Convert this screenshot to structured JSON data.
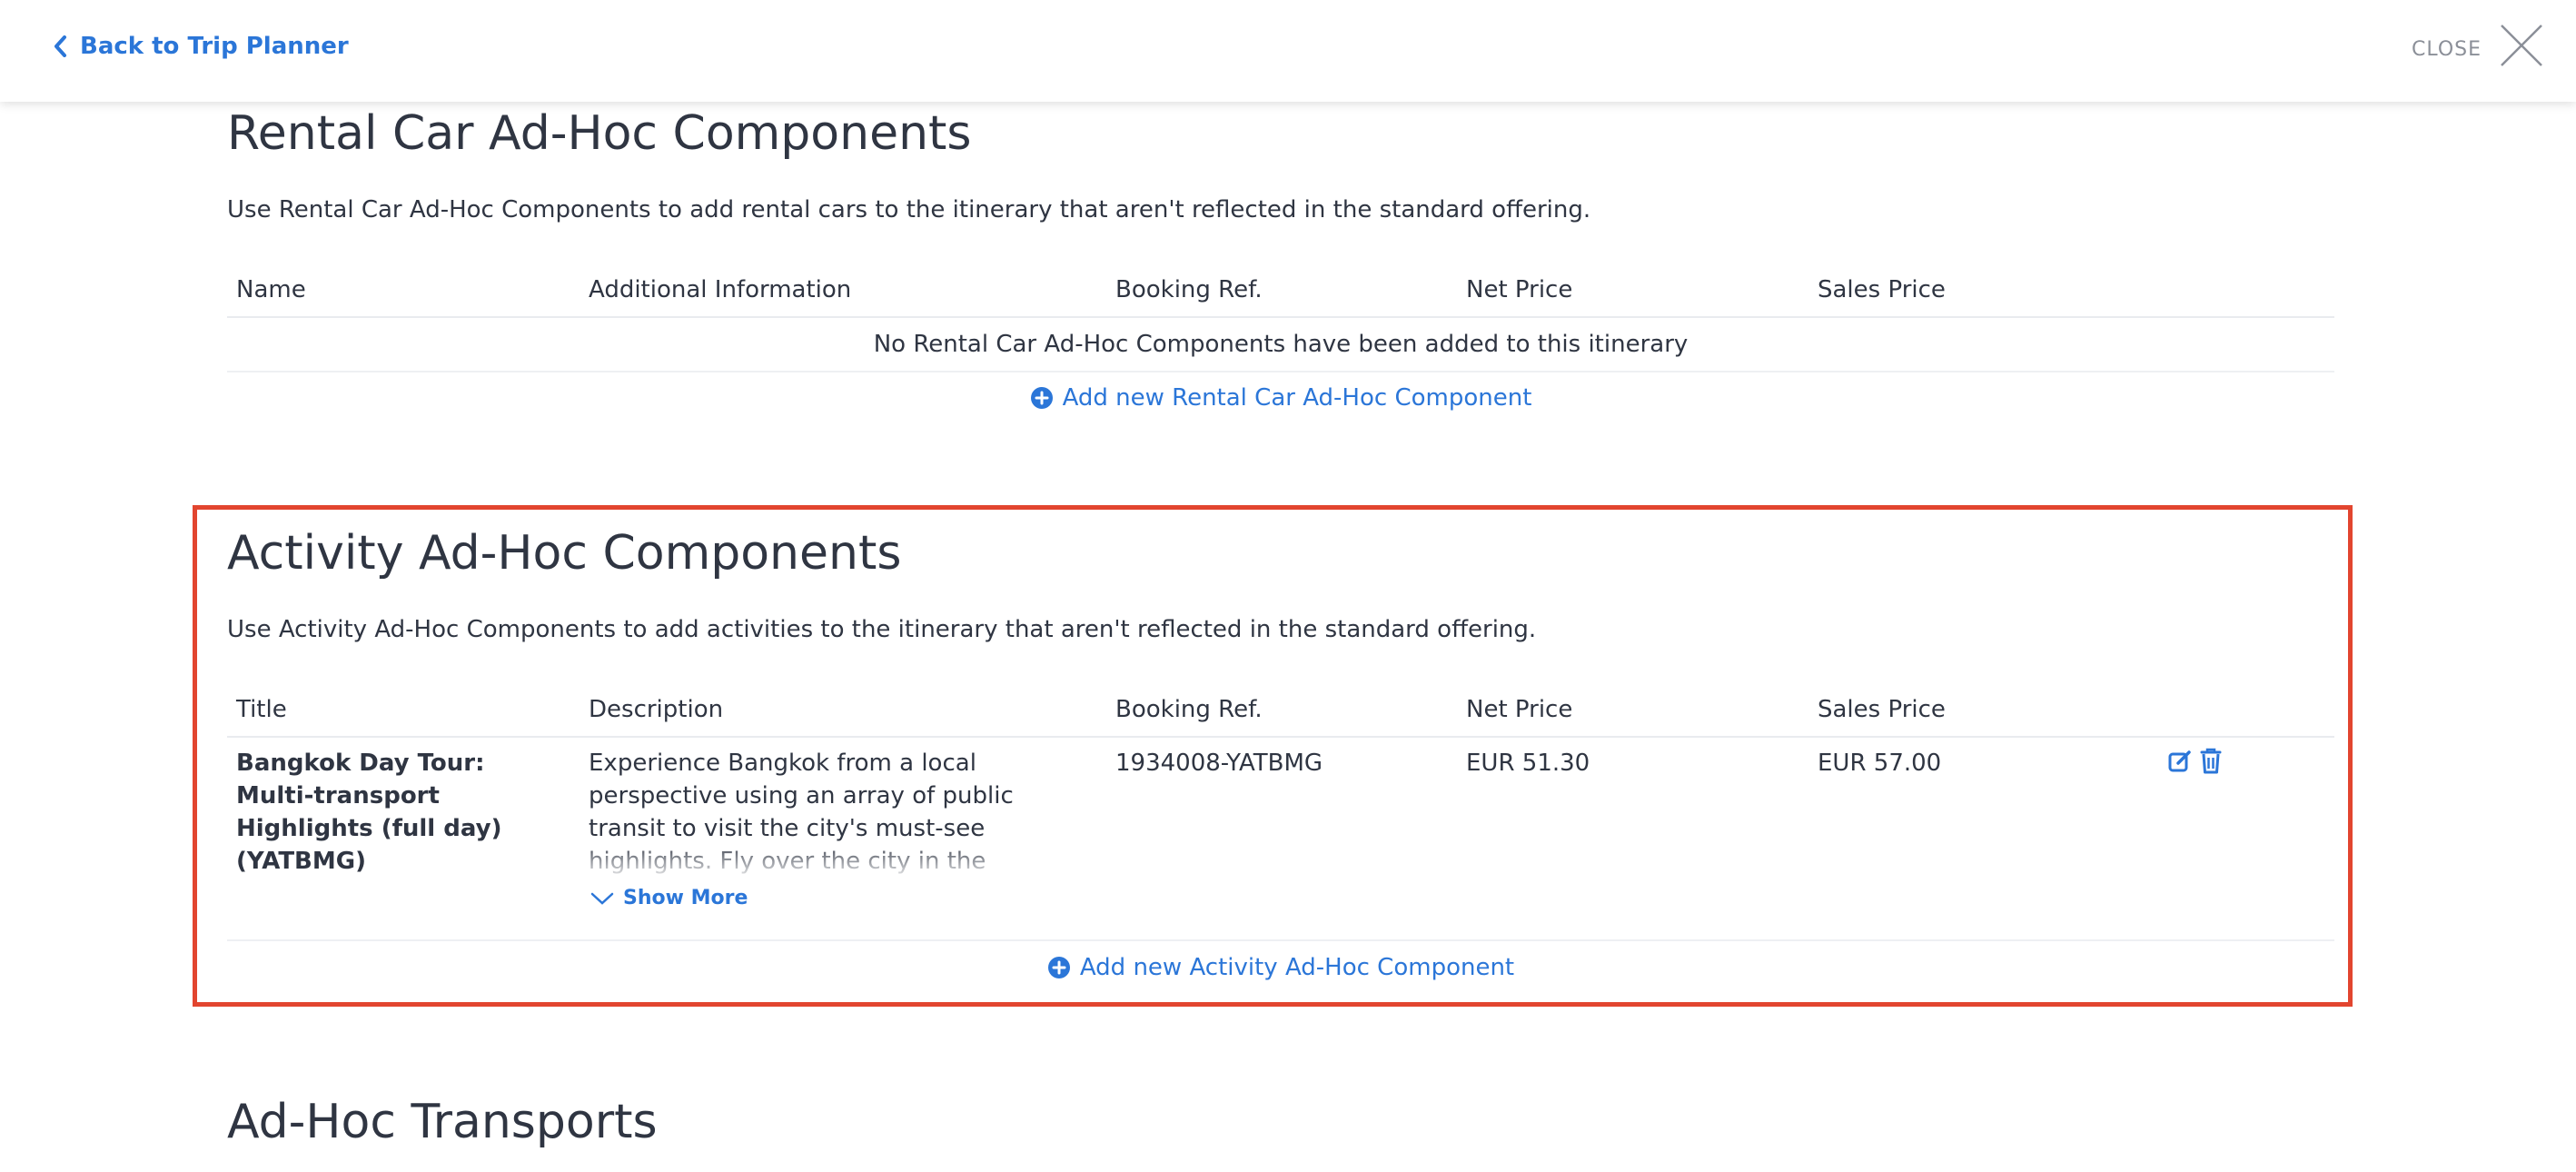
{
  "topbar": {
    "back_label": "Back to Trip Planner",
    "close_label": "CLOSE"
  },
  "rental": {
    "title": "Rental Car Ad-Hoc Components",
    "description": "Use Rental Car Ad-Hoc Components to add rental cars to the itinerary that aren't reflected in the standard offering.",
    "columns": [
      "Name",
      "Additional Information",
      "Booking Ref.",
      "Net Price",
      "Sales Price"
    ],
    "empty_text": "No Rental Car Ad-Hoc Components have been added to this itinerary",
    "add_label": "Add new Rental Car Ad-Hoc Component"
  },
  "activity": {
    "title": "Activity Ad-Hoc Components",
    "description": "Use Activity Ad-Hoc Components to add activities to the itinerary that aren't reflected in the standard offering.",
    "columns": [
      "Title",
      "Description",
      "Booking Ref.",
      "Net Price",
      "Sales Price"
    ],
    "rows": [
      {
        "title": "Bangkok Day Tour: Multi-transport Highlights (full day) (YATBMG)",
        "description": "Experience Bangkok from a local perspective using an array of public transit to visit the city's must-see highlights. Fly over the city in the Skytrain, whip through traffic on",
        "booking_ref": "1934008-YATBMG",
        "net_price": "EUR 51.30",
        "sales_price": "EUR 57.00",
        "show_more_label": "Show More"
      }
    ],
    "add_label": "Add new Activity Ad-Hoc Component"
  },
  "transports": {
    "title": "Ad-Hoc Transports"
  },
  "colors": {
    "accent": "#2b76d8",
    "highlight_border": "#e2452f",
    "text": "#2f3542"
  },
  "icons": [
    "chevron-left-icon",
    "close-icon",
    "plus-circle-icon",
    "chevron-down-icon",
    "edit-icon",
    "trash-icon"
  ]
}
